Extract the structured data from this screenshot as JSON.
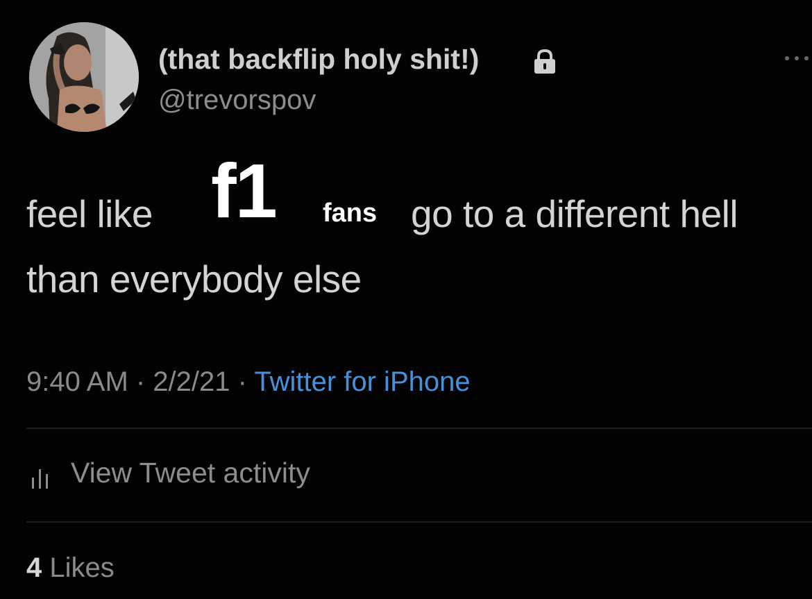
{
  "header": {
    "display_name": "(that backflip holy shit!)",
    "handle": "@trevorspov",
    "lock_icon": "lock-icon",
    "more_icon": "more-options-icon"
  },
  "tweet": {
    "line1_start": "feel like",
    "overlay_big": "f1",
    "overlay_small": "fans",
    "line1_end": "go to a different hell",
    "line2": "than everybody else"
  },
  "meta": {
    "time": "9:40 AM",
    "date": "2/2/21",
    "separator": " · ",
    "source": "Twitter for iPhone"
  },
  "activity": {
    "label": "View Tweet activity",
    "icon": "bar-chart-icon"
  },
  "likes": {
    "count": "4",
    "label": "Likes"
  },
  "colors": {
    "background": "#030303",
    "link": "#4a90d9",
    "secondary_text": "#8a8a8a"
  }
}
